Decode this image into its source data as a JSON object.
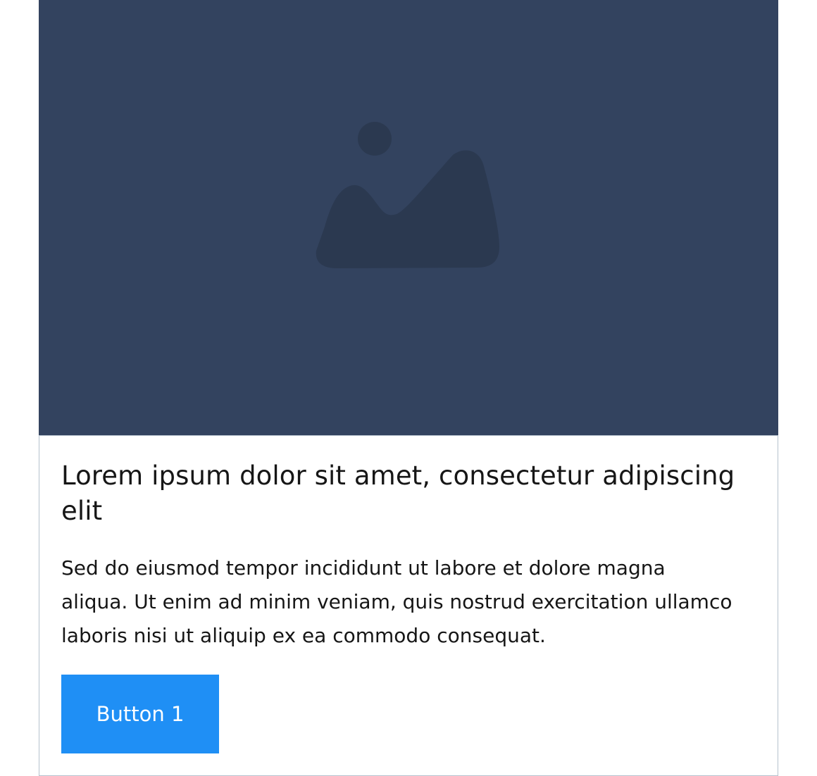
{
  "card": {
    "media": {
      "icon": "image-placeholder-icon",
      "background_color": "#33435f",
      "icon_color": "#2b3950"
    },
    "title": "Lorem ipsum dolor sit amet, consectetur adipiscing elit",
    "description": "Sed do eiusmod tempor incididunt ut labore et dolore magna aliqua. Ut enim ad minim veniam, quis nostrud exercitation ullamco laboris nisi ut aliquip ex ea commodo consequat.",
    "button": {
      "label": "Button 1",
      "background_color": "#1f8ff5"
    }
  }
}
